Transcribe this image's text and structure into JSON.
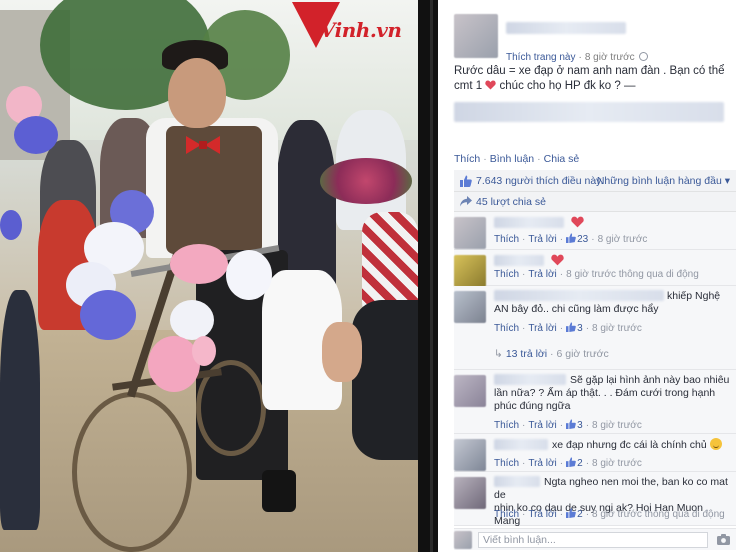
{
  "watermark": {
    "logo_text": "Vinh.vn"
  },
  "post": {
    "author_name": "",
    "meta": {
      "follow_link": "Thích trang này",
      "time": "8 giờ trước"
    },
    "text_line1": "Rước dâu = xe đạp ở nam anh nam đàn . Bạn có thể",
    "text_line2_before": "cmt 1",
    "text_line2_after": "chúc cho họ HP đk ko ? —",
    "actions": {
      "like": "Thích",
      "comment": "Bình luận",
      "share": "Chia sẻ"
    },
    "likes": {
      "count_text": "7.643 người thích điều này.",
      "sort_label": "Những bình luận hàng đầu"
    },
    "shares": {
      "count_text": "45 lượt chia sẻ"
    }
  },
  "comments": [
    {
      "text": "",
      "like_label": "Thích",
      "reply_label": "Trả lời",
      "likes": "23",
      "time": "8 giờ trước",
      "via": ""
    },
    {
      "text": "",
      "like_label": "Thích",
      "reply_label": "Trả lời",
      "likes": "",
      "time": "8 giờ trước",
      "via": "thông qua di động"
    },
    {
      "text_line1": "khiếp Nghệ",
      "text_line2": "AN bây đỏ.. chi cũng làm được hẩy",
      "like_label": "Thích",
      "reply_label": "Trả lời",
      "likes": "3",
      "time": "8 giờ trước",
      "replies": "13 trả lời",
      "replies_time": "6 giờ trước"
    },
    {
      "text_line1": "Sẽ gặp lại hình ảnh này bao nhiêu",
      "text_line2": "lần nữa? ? Ấm áp thật. . . Đám cưới trong hạnh",
      "text_line3": "phúc đúng ngữa",
      "like_label": "Thích",
      "reply_label": "Trả lời",
      "likes": "3",
      "time": "8 giờ trước"
    },
    {
      "text": "xe đạp nhưng đc cái là chính chủ",
      "like_label": "Thích",
      "reply_label": "Trả lời",
      "likes": "2",
      "time": "8 giờ trước"
    },
    {
      "text_line1": "Ngta ngheo nen moi the, ban ko co mat de",
      "text_line2": "nhin ko co dau de suy ngi ak? Hoi Han Muon Mang",
      "like_label": "Thích",
      "reply_label": "Trả lời",
      "likes": "2",
      "time": "8 giờ trước",
      "via": "thông qua di động"
    }
  ],
  "composer": {
    "placeholder": "Viết bình luận..."
  },
  "colors": {
    "link": "#3b5998",
    "meta": "#9197a3",
    "heart": "#e0485a",
    "watermark_red": "#d2222a"
  },
  "icons": [
    "globe-icon",
    "heart-icon",
    "thumbs-up-icon",
    "share-icon",
    "like-mini-icon",
    "reply-arrow-icon",
    "smiley-icon",
    "camera-icon"
  ]
}
